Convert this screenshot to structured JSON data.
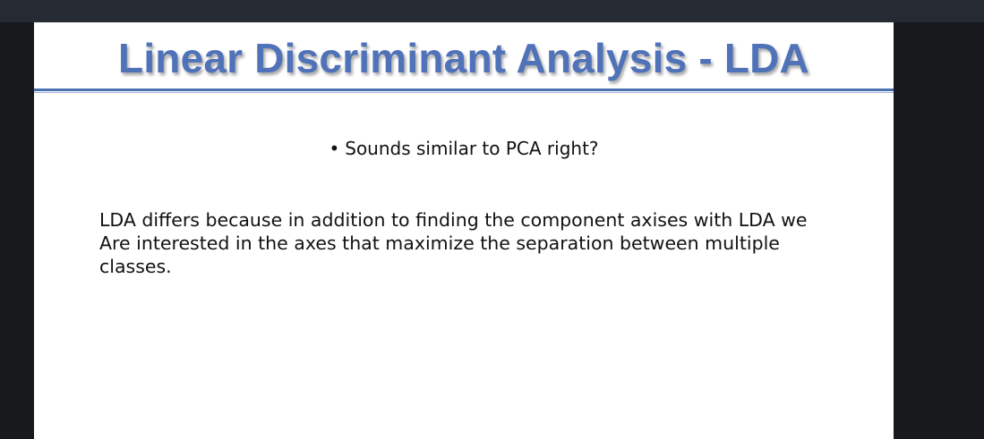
{
  "slide": {
    "title": "Linear Discriminant Analysis - LDA",
    "bullet_symbol": "•",
    "bullet_text": "Sounds similar to PCA right?",
    "body_lines": [
      "LDA differs because in addition to finding the component axises with LDA we",
      "Are interested in the axes that maximize the separation between multiple",
      "classes."
    ]
  },
  "colors": {
    "title": "#4f72b8",
    "rule": "#4a6fb0",
    "background": "#17191d",
    "top_bar": "#262a33",
    "slide_bg": "#ffffff"
  }
}
